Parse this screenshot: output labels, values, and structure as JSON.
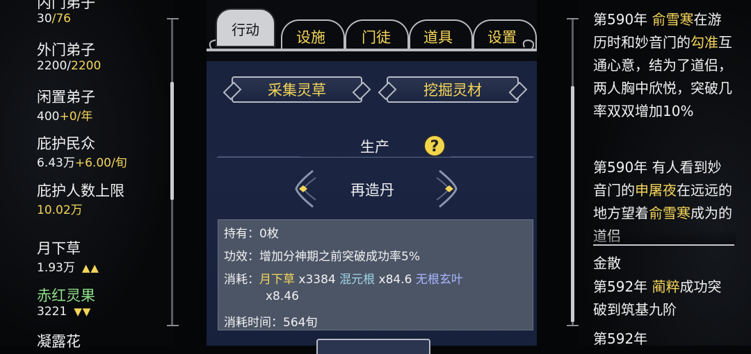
{
  "left": {
    "inner_disciples": {
      "label": "内门弟子",
      "value": "30",
      "max": "/76"
    },
    "outer_disciples": {
      "label": "外门弟子",
      "value": "2200/",
      "max": "2200"
    },
    "idle_disciples": {
      "label": "闲置弟子",
      "value": "400",
      "rate": "+0/年"
    },
    "protected_people": {
      "label": "庇护民众",
      "value": "6.43万",
      "rate": "+6.00/旬"
    },
    "protect_limit": {
      "label": "庇护人数上限",
      "value": "10.02万"
    },
    "herb_1": {
      "label": "月下草",
      "value": "1.93万",
      "trend": "▲▲"
    },
    "herb_2": {
      "label": "赤红灵果",
      "value": "3221",
      "trend": "▼▼"
    },
    "herb_3": {
      "label": "凝露花"
    }
  },
  "tabs": [
    {
      "label": "行动",
      "active": true
    },
    {
      "label": "设施"
    },
    {
      "label": "门徒"
    },
    {
      "label": "道具"
    },
    {
      "label": "设置"
    }
  ],
  "actions": {
    "gather": "采集灵草",
    "dig": "挖掘灵材"
  },
  "production": {
    "section_label": "生产",
    "help": "?",
    "item_name": "再造丹",
    "owned": "持有：0枚",
    "effect": "功效：增加分神期之前突破成功率5%",
    "cost_label": "消耗：",
    "materials": [
      {
        "name": "月下草",
        "qty": " x3384 "
      },
      {
        "name": "混元根",
        "qty": " x84.6 "
      },
      {
        "name": "无根玄叶",
        "qty": ""
      }
    ],
    "cost_cont": "x8.46",
    "time": "消耗时间：564旬"
  },
  "log": {
    "entry1": {
      "year": "第590年 ",
      "name1": "俞雪寒",
      "t1": "在游历时和妙音门的",
      "name2": "勾准",
      "t2": "互通心意，结为了道侣，两人胸中欣悦，突破几率双双增加10%"
    },
    "entry2": {
      "year": "第590年 有人看到妙音门的",
      "name1": "申屠夜",
      "t1": "在远远的地方望着",
      "name2": "俞雪寒",
      "t2": "成为的道侣"
    },
    "entry3_tail": "金散",
    "entry4": {
      "year": "第592年 ",
      "name1": "蔺粹",
      "t1": "成功突破到筑基九阶"
    },
    "entry5": {
      "year": "第592年"
    }
  },
  "colors": {
    "accent_yellow": "#f5d65a",
    "panel_blue": "#1b2542",
    "info_gray": "#4c5566"
  }
}
